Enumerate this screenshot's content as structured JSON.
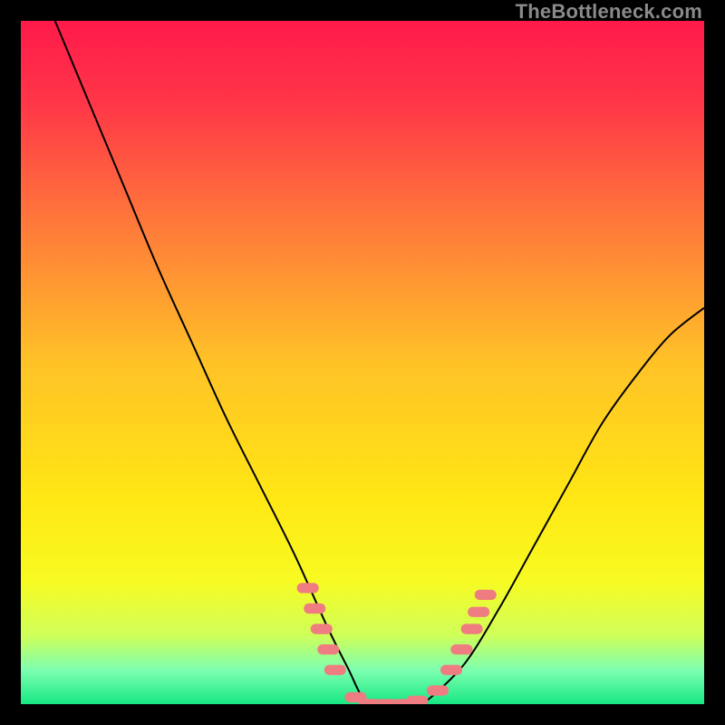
{
  "watermark": "TheBottleneck.com",
  "chart_data": {
    "type": "line",
    "title": "",
    "xlabel": "",
    "ylabel": "",
    "xlim": [
      0,
      100
    ],
    "ylim": [
      0,
      100
    ],
    "grid": false,
    "legend": false,
    "background": {
      "style": "vertical-gradient",
      "stops": [
        {
          "pos": 0.0,
          "color": "#ff1a4b"
        },
        {
          "pos": 0.12,
          "color": "#ff3648"
        },
        {
          "pos": 0.3,
          "color": "#ff7a3a"
        },
        {
          "pos": 0.5,
          "color": "#ffc227"
        },
        {
          "pos": 0.7,
          "color": "#ffe714"
        },
        {
          "pos": 0.82,
          "color": "#f7fb22"
        },
        {
          "pos": 0.9,
          "color": "#cfff5a"
        },
        {
          "pos": 0.95,
          "color": "#7dffb0"
        },
        {
          "pos": 1.0,
          "color": "#17e884"
        }
      ],
      "description": "Rainbow thermal gradient red→orange→yellow→green"
    },
    "series": [
      {
        "name": "bottleneck-curve",
        "color": "#000000",
        "stroke_width": 2,
        "x": [
          5,
          10,
          15,
          20,
          25,
          30,
          35,
          40,
          45,
          48,
          50,
          52,
          55,
          58,
          60,
          65,
          70,
          75,
          80,
          85,
          90,
          95,
          100
        ],
        "y": [
          100,
          88,
          76,
          64,
          53,
          42,
          32,
          22,
          11,
          5,
          1,
          0,
          0,
          0,
          1,
          6,
          14,
          23,
          32,
          41,
          48,
          54,
          58
        ]
      }
    ],
    "markers": {
      "name": "highlight-dashes",
      "color": "#ef7c80",
      "shape": "rounded-dash",
      "approx_width": 3.2,
      "approx_height": 1.5,
      "points": [
        {
          "x": 42,
          "y": 17
        },
        {
          "x": 43,
          "y": 14
        },
        {
          "x": 44,
          "y": 11
        },
        {
          "x": 45,
          "y": 8
        },
        {
          "x": 46,
          "y": 5
        },
        {
          "x": 49,
          "y": 1
        },
        {
          "x": 51,
          "y": 0
        },
        {
          "x": 53.5,
          "y": 0
        },
        {
          "x": 56,
          "y": 0
        },
        {
          "x": 58,
          "y": 0.5
        },
        {
          "x": 61,
          "y": 2
        },
        {
          "x": 63,
          "y": 5
        },
        {
          "x": 64.5,
          "y": 8
        },
        {
          "x": 66,
          "y": 11
        },
        {
          "x": 67,
          "y": 13.5
        },
        {
          "x": 68,
          "y": 16
        }
      ]
    }
  }
}
